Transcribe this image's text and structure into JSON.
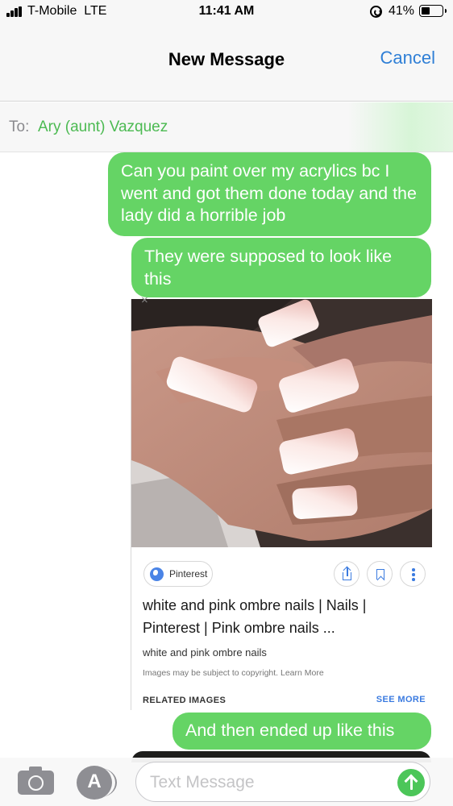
{
  "status_bar": {
    "carrier": "T-Mobile",
    "network": "LTE",
    "time": "11:41 AM",
    "battery_percent": "41%",
    "battery_level": 0.41,
    "icons": [
      "signal-bars-icon",
      "orientation-lock-icon",
      "battery-icon"
    ]
  },
  "header": {
    "title": "New Message",
    "cancel_label": "Cancel"
  },
  "recipient": {
    "label": "To:",
    "name": "Ary (aunt) Vazquez"
  },
  "messages": [
    {
      "text": "Can you paint over my acrylics bc I went and got them done today and the lady did a horrible job"
    },
    {
      "text": "They were supposed to look like this"
    },
    {
      "text": "And then ended up like this"
    }
  ],
  "link_card": {
    "close_glyph": "×",
    "image_icon": "nail-photo",
    "source": "Pinterest",
    "title": "white and pink ombre nails | Nails | Pinterest | Pink ombre nails ...",
    "subtitle": "white and pink ombre nails",
    "copyright_note": "Images may be subject to copyright. Learn More",
    "related_label": "RELATED IMAGES",
    "see_more_label": "SEE MORE",
    "action_icons": [
      "share-icon",
      "bookmark-icon",
      "more-vert-icon"
    ]
  },
  "composer": {
    "placeholder": "Text Message",
    "icons": [
      "camera-icon",
      "app-store-icon",
      "send-arrow-icon"
    ]
  },
  "colors": {
    "bubble_green": "#65d465",
    "accent_blue": "#2f7fd6",
    "recipient_green": "#4cba52",
    "send_green": "#4cc659",
    "link_blue": "#3b7be0"
  }
}
